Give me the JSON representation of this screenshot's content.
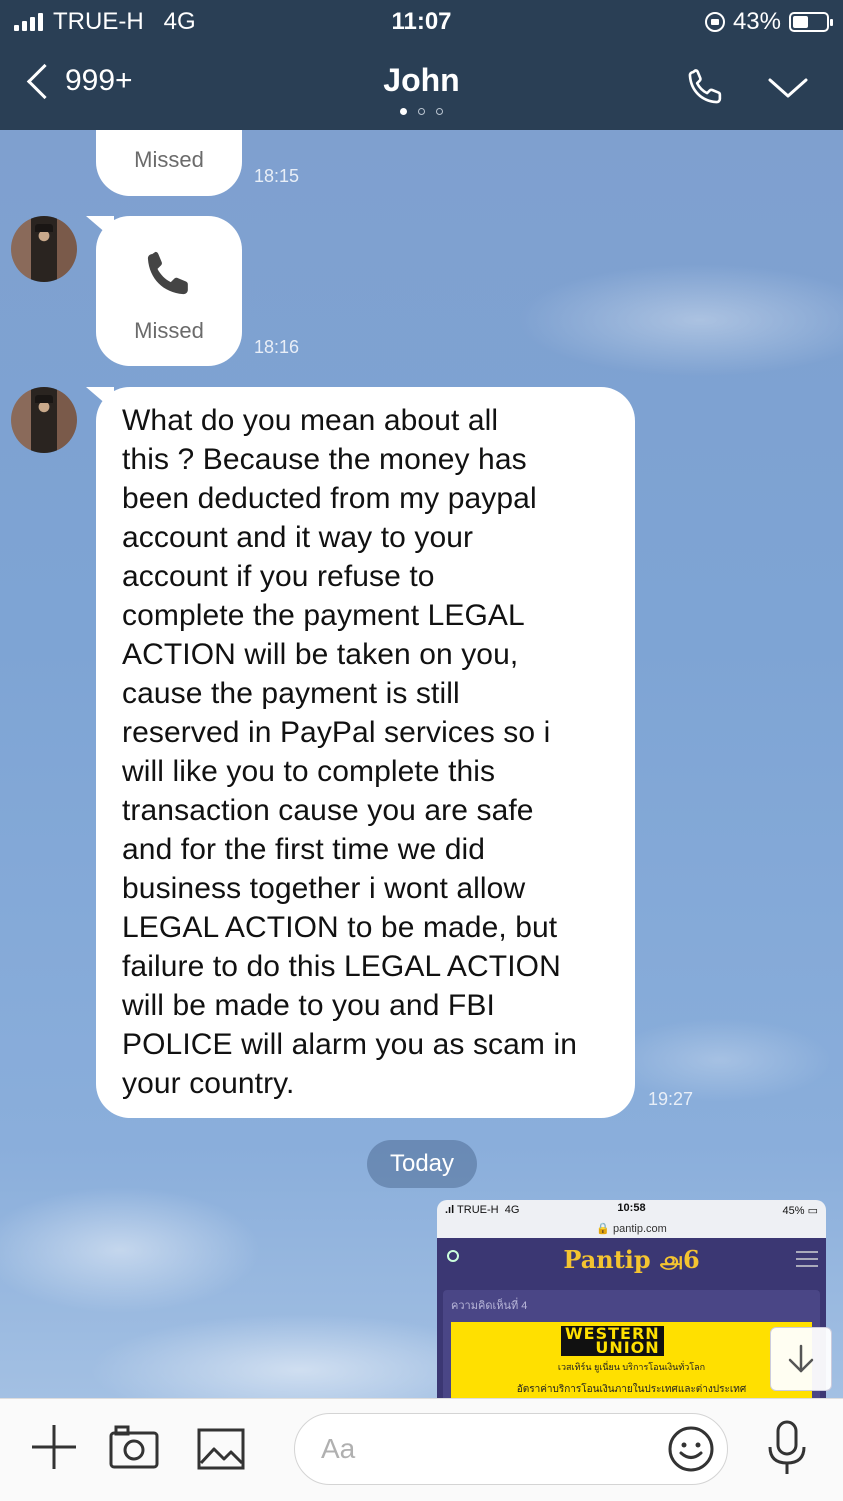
{
  "status_bar": {
    "carrier": "TRUE-H",
    "network": "4G",
    "time": "11:07",
    "battery": "43%"
  },
  "header": {
    "back_count": "999+",
    "title": "John",
    "page_dots": 3,
    "active_dot": 0,
    "icons": [
      "back-chevron-icon",
      "phone-icon",
      "chevron-down-icon"
    ]
  },
  "messages": [
    {
      "type": "missed-call",
      "label": "Missed",
      "time": "18:15"
    },
    {
      "type": "missed-call",
      "label": "Missed",
      "time": "18:16"
    },
    {
      "type": "text",
      "lines": [
        "What do you mean about all",
        "this ? Because the money has",
        "been deducted from my paypal",
        "account and it way to your",
        "account if you refuse to",
        "complete the payment LEGAL",
        "ACTION will be taken on you,",
        "cause the payment is still",
        "reserved in PayPal services so i",
        "will like you to complete this",
        "transaction cause you are safe",
        "and for the first time we did",
        "business together i wont allow",
        "LEGAL ACTION to be made, but",
        "failure to do this LEGAL ACTION",
        "will be made to you and FBI",
        "POLICE will alarm you as scam in",
        "your country."
      ],
      "time": "19:27"
    }
  ],
  "date_divider": "Today",
  "shared_screenshot": {
    "carrier": "TRUE-H",
    "network": "4G",
    "time": "10:58",
    "battery": "45%",
    "url": "pantip.com",
    "site_name": "Pantip",
    "caption": "ความคิดเห็นที่ 4",
    "brand_line1": "WESTERN",
    "brand_line2": "UNION",
    "brand_sub": "เวสเทิร์น ยูเนี่ยน บริการโอนเงินทั่วโลก",
    "brand_sub2": "อัตราค่าบริการโอนเงินภายในประเทศและต่างประเทศ"
  },
  "composer": {
    "placeholder": "Aa",
    "icons": [
      "plus-icon",
      "camera-icon",
      "image-icon",
      "emoji-icon",
      "microphone-icon"
    ]
  },
  "colors": {
    "header_bg": "#2a3f55",
    "chat_bg": "#7ea4d4",
    "bubble": "#ffffff"
  }
}
